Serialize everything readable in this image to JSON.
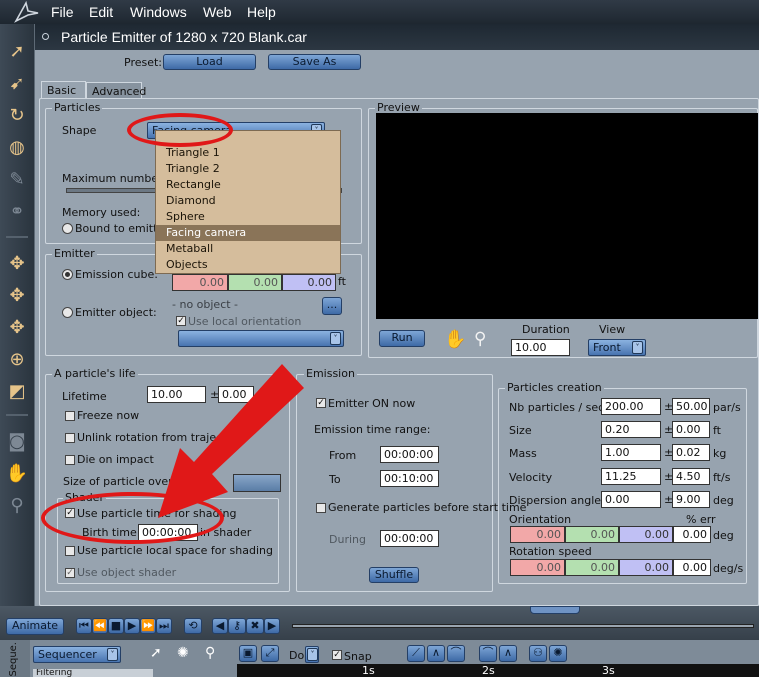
{
  "menu": [
    "File",
    "Edit",
    "Windows",
    "Web",
    "Help"
  ],
  "window": {
    "title": "Particle Emitter of 1280 x 720 Blank.car"
  },
  "preset": {
    "label": "Preset:",
    "load": "Load",
    "save_as": "Save As"
  },
  "tabs": [
    "Basic",
    "Advanced"
  ],
  "particles": {
    "group": "Particles",
    "shape_label": "Shape",
    "shape_value": "Facing camera",
    "max_number_label": "Maximum number of",
    "memory_label": "Memory used:",
    "bound_label": "Bound to emitter",
    "options": [
      "Triangle 1",
      "Triangle 2",
      "Rectangle",
      "Diamond",
      "Sphere",
      "Facing camera",
      "Metaball",
      "Objects"
    ]
  },
  "emitter": {
    "group": "Emitter",
    "cube_label": "Emission cube:",
    "cube_values": [
      "0.00",
      "0.00",
      "0.00"
    ],
    "cube_unit": "ft",
    "object_label": "Emitter object:",
    "no_object": "- no object -",
    "browse": "...",
    "local_orient": "Use local orientation"
  },
  "preview": {
    "group": "Preview",
    "run": "Run",
    "duration_label": "Duration",
    "duration_value": "10.00",
    "view_label": "View",
    "view_value": "Front"
  },
  "life": {
    "group": "A particle's life",
    "lifetime_label": "Lifetime",
    "lifetime_value": "10.00",
    "lifetime_pm": "0.00",
    "freeze": "Freeze now",
    "unlink": "Unlink rotation from trajectory",
    "die": "Die on impact",
    "size_over": "Size of particle over its li",
    "shader_group": "Shader",
    "use_time": "Use particle time for shading",
    "birth_label": "Birth time is",
    "birth_value": "00:00:00",
    "in_shader": "in shader",
    "local_space": "Use particle local space for shading",
    "object_shader": "Use object shader"
  },
  "emission": {
    "group": "Emission",
    "on_label": "Emitter ON now",
    "range_label": "Emission time range:",
    "from_label": "From",
    "from_value": "00:00:00",
    "to_label": "To",
    "to_value": "00:10:00",
    "generate_label": "Generate particles before start time",
    "during_label": "During",
    "during_value": "00:00:00",
    "shuffle": "Shuffle"
  },
  "creation": {
    "group": "Particles creation",
    "rows": [
      {
        "label": "Nb particles / sec",
        "value": "200.00",
        "pm": "50.00",
        "unit": "par/s"
      },
      {
        "label": "Size",
        "value": "0.20",
        "pm": "0.00",
        "unit": "ft"
      },
      {
        "label": "Mass",
        "value": "1.00",
        "pm": "0.02",
        "unit": "kg"
      },
      {
        "label": "Velocity",
        "value": "11.25",
        "pm": "4.50",
        "unit": "ft/s"
      },
      {
        "label": "Dispersion angle",
        "value": "0.00",
        "pm": "9.00",
        "unit": "deg"
      }
    ],
    "orientation_label": "Orientation",
    "err_label": "% err",
    "orientation_values": [
      "0.00",
      "0.00",
      "0.00",
      "0.00"
    ],
    "orientation_unit": "deg",
    "rotation_label": "Rotation speed",
    "rotation_values": [
      "0.00",
      "0.00",
      "0.00",
      "0.00"
    ],
    "rotation_unit": "deg/s"
  },
  "timeline": {
    "animate": "Animate",
    "sequencer": "Sequencer",
    "do_label": "Do:",
    "snap": "Snap",
    "filtering": "Filtering",
    "seque": "Seque.",
    "ticks": [
      "1s",
      "2s",
      "3s"
    ]
  },
  "colors": {
    "accent": "#3e6aa6",
    "annotation": "#e01818",
    "dropdown_bg": "#d5bd9c"
  }
}
